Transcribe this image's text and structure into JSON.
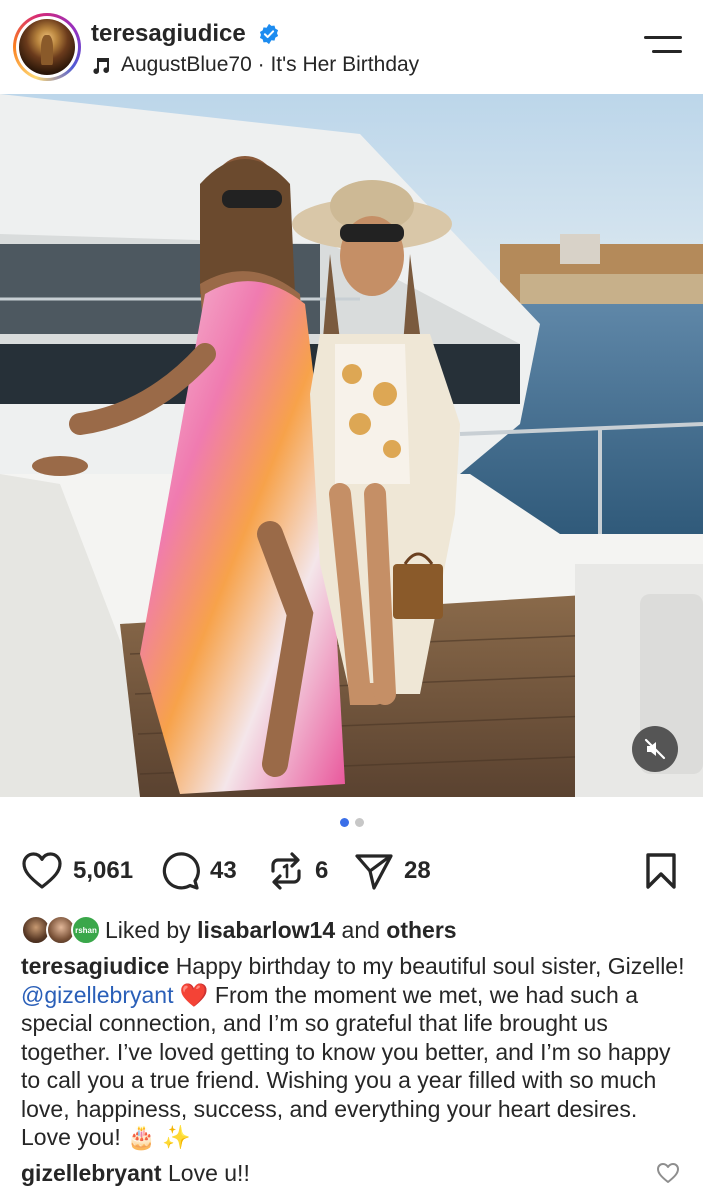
{
  "post": {
    "username": "teresagiudice",
    "verified": true,
    "audio_artist": "AugustBlue70",
    "audio_separator": " · ",
    "audio_title": "It's Her Birthday"
  },
  "media": {
    "carousel_total": 2,
    "carousel_active": 1
  },
  "actions": {
    "likes": "5,061",
    "comments": "43",
    "reposts": "6",
    "shares": "28"
  },
  "liked_by": {
    "prefix": "Liked by",
    "user": "lisabarlow14",
    "joiner": "and",
    "others": "others",
    "third_avatar_text": "rshan"
  },
  "caption": {
    "user": "teresagiudice",
    "text_before_mention": "Happy birthday to my beautiful soul sister, Gizelle!",
    "mention": "@gizellebryant",
    "heart": "❤️",
    "text_after_mention": "From the moment we met, we had such a special connection, and I’m so grateful that life brought us together. I’ve loved getting to know you better, and I’m so happy to call you a true friend. Wishing you a year filled with so much love, happiness, success, and everything your heart desires. Love you!",
    "emojis": "🎂 ✨"
  },
  "comment": {
    "user": "gizellebryant",
    "text": "Love u!!"
  },
  "colors": {
    "text": "#262626",
    "mention": "#2a5fb8",
    "dot_active": "#3b6fe8",
    "dot_inactive": "#c7c7c7",
    "verified": "#1d8cf0"
  },
  "icons": {
    "menu": "menu-icon",
    "music": "music-note-icon",
    "like": "heart-icon",
    "comment": "comment-icon",
    "repost": "repost-icon",
    "share": "send-icon",
    "save": "bookmark-icon",
    "mute": "muted-speaker-icon"
  }
}
